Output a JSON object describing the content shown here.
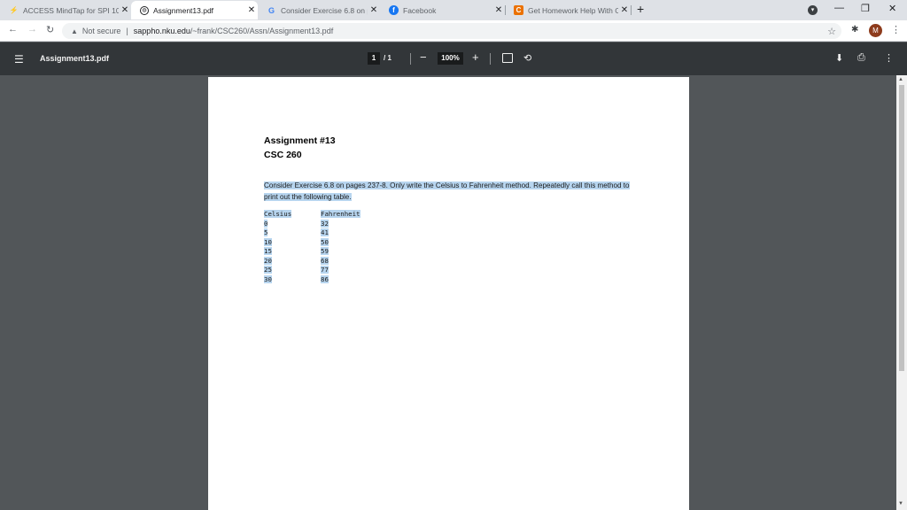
{
  "browser": {
    "tabs": [
      {
        "title": "ACCESS MindTap for SPI 10",
        "icon": "lightning-icon",
        "active": false
      },
      {
        "title": "Assignment13.pdf",
        "icon": "globe-icon",
        "active": true
      },
      {
        "title": "Consider Exercise 6.8 on pa",
        "icon": "google-icon",
        "active": false
      },
      {
        "title": "Facebook",
        "icon": "facebook-icon",
        "active": false
      },
      {
        "title": "Get Homework Help With C",
        "icon": "chegg-icon",
        "active": false
      }
    ],
    "close_glyph": "✕",
    "new_tab_glyph": "+",
    "address": {
      "security": "Not secure",
      "host": "sappho.nku.edu",
      "path": "/~frank/CSC260/Assn/Assignment13.pdf"
    },
    "profile_initial": "M",
    "colors": {
      "active_tab": "#ffffff",
      "tab_strip": "#dee1e6",
      "avatar": "#8d3b1c"
    }
  },
  "viewer": {
    "file_name": "Assignment13.pdf",
    "current_page": "1",
    "page_total": "/ 1",
    "zoom": "100%",
    "colors": {
      "toolbar": "#323639",
      "background": "#525659"
    }
  },
  "document": {
    "title": "Assignment #13",
    "course": "CSC 260",
    "instructions": "Consider Exercise 6.8 on pages 237-8.  Only write the Celsius to Fahrenheit method.  Repeatedly call this method to print out the following table.",
    "highlight_color": "#b7d5ef",
    "table": {
      "headers": [
        "Celsius",
        "Fahrenheit"
      ],
      "rows": [
        [
          "0",
          "32"
        ],
        [
          "5",
          "41"
        ],
        [
          "10",
          "50"
        ],
        [
          "15",
          "59"
        ],
        [
          "20",
          "68"
        ],
        [
          "25",
          "77"
        ],
        [
          "30",
          "86"
        ]
      ]
    }
  }
}
